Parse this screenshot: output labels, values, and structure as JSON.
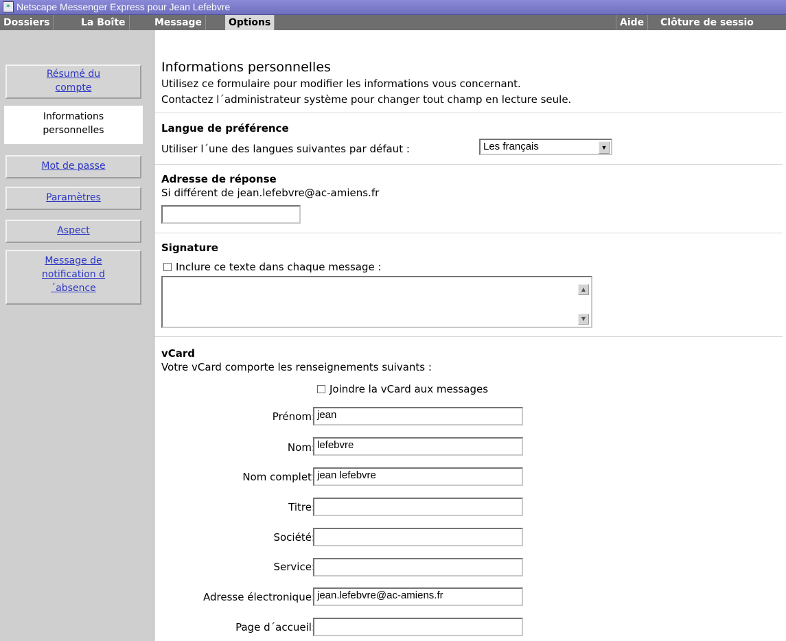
{
  "window": {
    "title": "Netscape Messenger Express pour  Jean Lefebvre"
  },
  "menubar": {
    "left": [
      "Dossiers",
      "La Boîte",
      "Message",
      "Options"
    ],
    "right": [
      "Aide",
      "Clôture de sessio"
    ]
  },
  "sidebar": {
    "items": [
      {
        "label": "Résumé du compte"
      },
      {
        "label": "Informations personnelles"
      },
      {
        "label": "Mot de passe"
      },
      {
        "label": "Paramètres"
      },
      {
        "label": "Aspect"
      },
      {
        "label": "Message de notification d´absence"
      }
    ]
  },
  "page": {
    "title": "Informations personnelles",
    "intro1": "Utilisez ce formulaire pour modifier les informations vous concernant.",
    "intro2": "Contactez l´administrateur système pour changer tout champ en lecture seule."
  },
  "language": {
    "heading": "Langue de préférence",
    "label": "Utiliser l´une des langues suivantes par défaut :",
    "selected": "Les français"
  },
  "reply": {
    "heading": "Adresse de réponse",
    "label": "Si différent de jean.lefebvre@ac-amiens.fr",
    "value": ""
  },
  "signature": {
    "heading": "Signature",
    "checkbox_label": "Inclure ce texte dans chaque message :",
    "value": ""
  },
  "vcard": {
    "heading": "vCard",
    "desc": "Votre vCard comporte les renseignements suivants :",
    "attach_label": "Joindre la vCard aux messages",
    "fields": [
      {
        "label": "Prénom:",
        "value": "jean"
      },
      {
        "label": "Nom:",
        "value": "lefebvre"
      },
      {
        "label": "Nom complet:",
        "value": "jean lefebvre"
      },
      {
        "label": "Titre:",
        "value": ""
      },
      {
        "label": "Société:",
        "value": ""
      },
      {
        "label": "Service:",
        "value": ""
      },
      {
        "label": "Adresse électronique:",
        "value": "jean.lefebvre@ac-amiens.fr"
      },
      {
        "label": "Page d´accueil:",
        "value": ""
      }
    ]
  }
}
